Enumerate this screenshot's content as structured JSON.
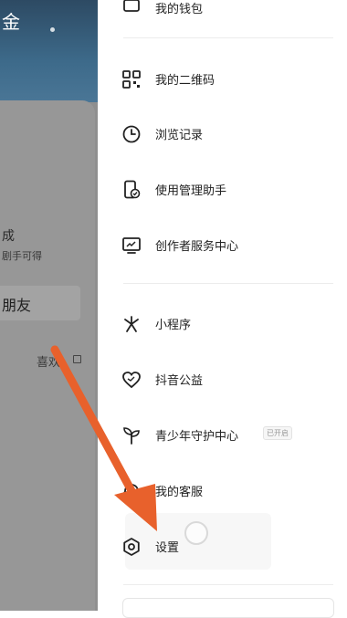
{
  "background": {
    "title_fragment": "金",
    "text_fragment_1": "成",
    "text_fragment_2": "剧手可得",
    "button_fragment": "朋友",
    "like_tab": "喜欢"
  },
  "drawer": {
    "top_partial_label": "我的钱包",
    "items": [
      {
        "label": "我的二维码",
        "icon": "qr-code-icon"
      },
      {
        "label": "浏览记录",
        "icon": "clock-icon"
      },
      {
        "label": "使用管理助手",
        "icon": "phone-manager-icon"
      },
      {
        "label": "创作者服务中心",
        "icon": "monitor-icon"
      },
      {
        "label": "小程序",
        "icon": "asterisk-icon"
      },
      {
        "label": "抖音公益",
        "icon": "heart-icon"
      },
      {
        "label": "青少年守护中心",
        "icon": "sprout-icon",
        "badge": "已开启"
      },
      {
        "label": "我的客服",
        "icon": "headset-icon"
      },
      {
        "label": "设置",
        "icon": "settings-icon"
      }
    ]
  },
  "annotation_color": "#e8612c"
}
